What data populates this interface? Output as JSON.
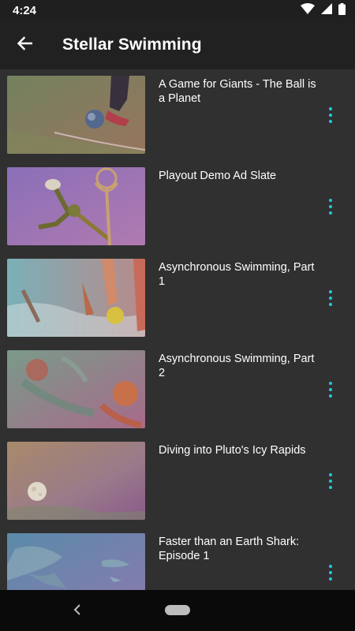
{
  "status_bar": {
    "time": "4:24",
    "icons": [
      "wifi-icon",
      "cellular-signal-icon",
      "battery-icon"
    ]
  },
  "app_bar": {
    "back_icon": "arrow-back-icon",
    "title": "Stellar Swimming"
  },
  "videos": [
    {
      "title": "A Game for Giants - The Ball is a Planet",
      "thumbnail": "soccer-kick-planet-ball",
      "menu_icon": "more-vert-icon"
    },
    {
      "title": "Playout Demo Ad Slate",
      "thumbnail": "frog-acrobat-trophy",
      "menu_icon": "more-vert-icon"
    },
    {
      "title": "Asynchronous Swimming, Part 1",
      "thumbnail": "water-polo-legs",
      "menu_icon": "more-vert-icon"
    },
    {
      "title": "Asynchronous Swimming, Part 2",
      "thumbnail": "underwater-swimmers",
      "menu_icon": "more-vert-icon"
    },
    {
      "title": "Diving into Pluto's Icy Rapids",
      "thumbnail": "moon-over-haze",
      "menu_icon": "more-vert-icon"
    },
    {
      "title": "Faster than an Earth Shark: Episode 1",
      "thumbnail": "shark-underwater",
      "menu_icon": "more-vert-icon"
    }
  ],
  "nav_bar": {
    "back_icon": "nav-back-chevron-icon",
    "home_icon": "home-pill-icon"
  },
  "colors": {
    "background": "#303030",
    "app_bar": "#212121",
    "status_bar": "#1f1f1f",
    "accent": "#26c6da",
    "text": "#ffffff"
  }
}
